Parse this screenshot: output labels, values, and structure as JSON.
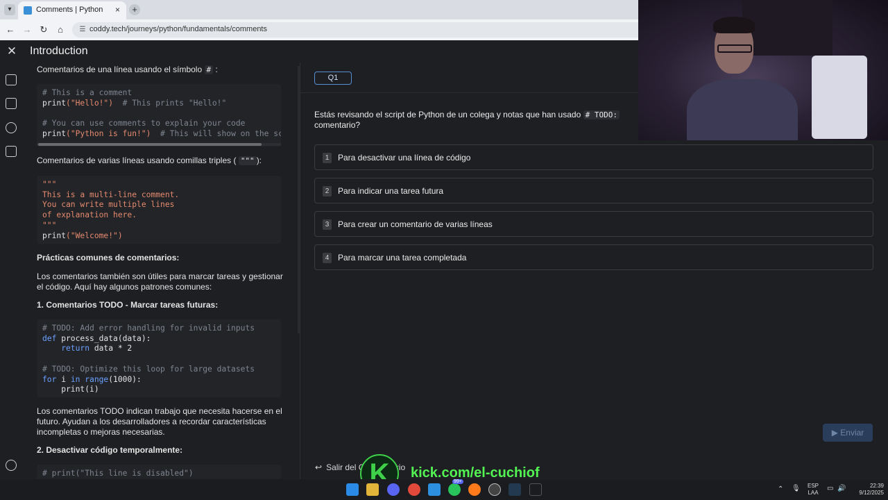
{
  "browser": {
    "tab_title": "Comments | Python",
    "url": "coddy.tech/journeys/python/fundamentals/comments",
    "tab_close": "×",
    "new_tab": "+",
    "nav_back": "←",
    "nav_forward": "→",
    "nav_reload": "↻",
    "nav_home": "⌂"
  },
  "header": {
    "close": "✕",
    "title": "Introduction"
  },
  "lesson": {
    "p1_prefix": "Comentarios de una línea usando el símbolo",
    "p1_symbol": "#",
    "p1_suffix": ":",
    "code1": [
      {
        "t": "# This is a comment",
        "c": "c-com"
      },
      {
        "t": "print",
        "c": "c-fn",
        "inline": true
      },
      {
        "t": "(\"Hello!\")",
        "c": "c-str",
        "inline": true
      },
      {
        "t": "  # This prints \"Hello!\"",
        "c": "c-com"
      },
      {
        "t": "",
        "c": ""
      },
      {
        "t": "# You can use comments to explain your code",
        "c": "c-com"
      },
      {
        "t": "print",
        "c": "c-fn",
        "inline": true
      },
      {
        "t": "(\"Python is fun!\")",
        "c": "c-str",
        "inline": true
      },
      {
        "t": "  # This will show on the scr",
        "c": "c-com"
      }
    ],
    "p2_prefix": "Comentarios de varias líneas usando comillas triples (",
    "p2_symbol": "\"\"\"",
    "p2_suffix": "):",
    "code2_l1": "\"\"\"",
    "code2_l2": "This is a multi-line comment.",
    "code2_l3": "You can write multiple lines",
    "code2_l4": "of explanation here.",
    "code2_l5": "\"\"\"",
    "code2_l6_fn": "print",
    "code2_l6_arg": "(\"Welcome!\")",
    "h_practices": "Prácticas comunes de comentarios:",
    "p3": "Los comentarios también son útiles para marcar tareas y gestionar el código. Aquí hay algunos patrones comunes:",
    "h_todo": "1. Comentarios TODO - Marcar tareas futuras:",
    "code3_l1": "# TODO: Add error handling for invalid inputs",
    "code3_l2_kw": "def",
    "code3_l2_rest": " process_data(data):",
    "code3_l3_kw": "    return",
    "code3_l3_rest": " data * 2",
    "code3_l5": "# TODO: Optimize this loop for large datasets",
    "code3_l6_kw1": "for",
    "code3_l6_mid": " i ",
    "code3_l6_kw2": "in",
    "code3_l6_kw3": " range",
    "code3_l6_rest": "(1000):",
    "code3_l7": "    print(i)",
    "p4": "Los comentarios TODO indican trabajo que necesita hacerse en el futuro. Ayudan a los desarrolladores a recordar características incompletas o mejoras necesarias.",
    "h_disable": "2. Desactivar código temporalmente:",
    "code4_l1": "# print(\"This line is disabled\")"
  },
  "quiz": {
    "tab_label": "Q1",
    "question_prefix": "Estás revisando el script de Python de un colega y notas que han usado",
    "question_code": "# TODO: ",
    "question_suffix": "comentario?",
    "options": [
      {
        "num": "1",
        "text": "Para desactivar una línea de código"
      },
      {
        "num": "2",
        "text": "Para indicar una tarea futura"
      },
      {
        "num": "3",
        "text": "Para crear un comentario de varias líneas"
      },
      {
        "num": "4",
        "text": "Para marcar una tarea completada"
      }
    ],
    "send_label": "Enviar",
    "send_icon": "▶",
    "exit_label": "Salir del Cuestionario",
    "exit_icon": "↩"
  },
  "overlay": {
    "kick_letter": "K",
    "kick_url": "kick.com/el-cuchiof"
  },
  "taskbar": {
    "lang_top": "ESP",
    "lang_bottom": "LAA",
    "time": "22:39",
    "date": "9/12/2025",
    "badge": "99+"
  }
}
